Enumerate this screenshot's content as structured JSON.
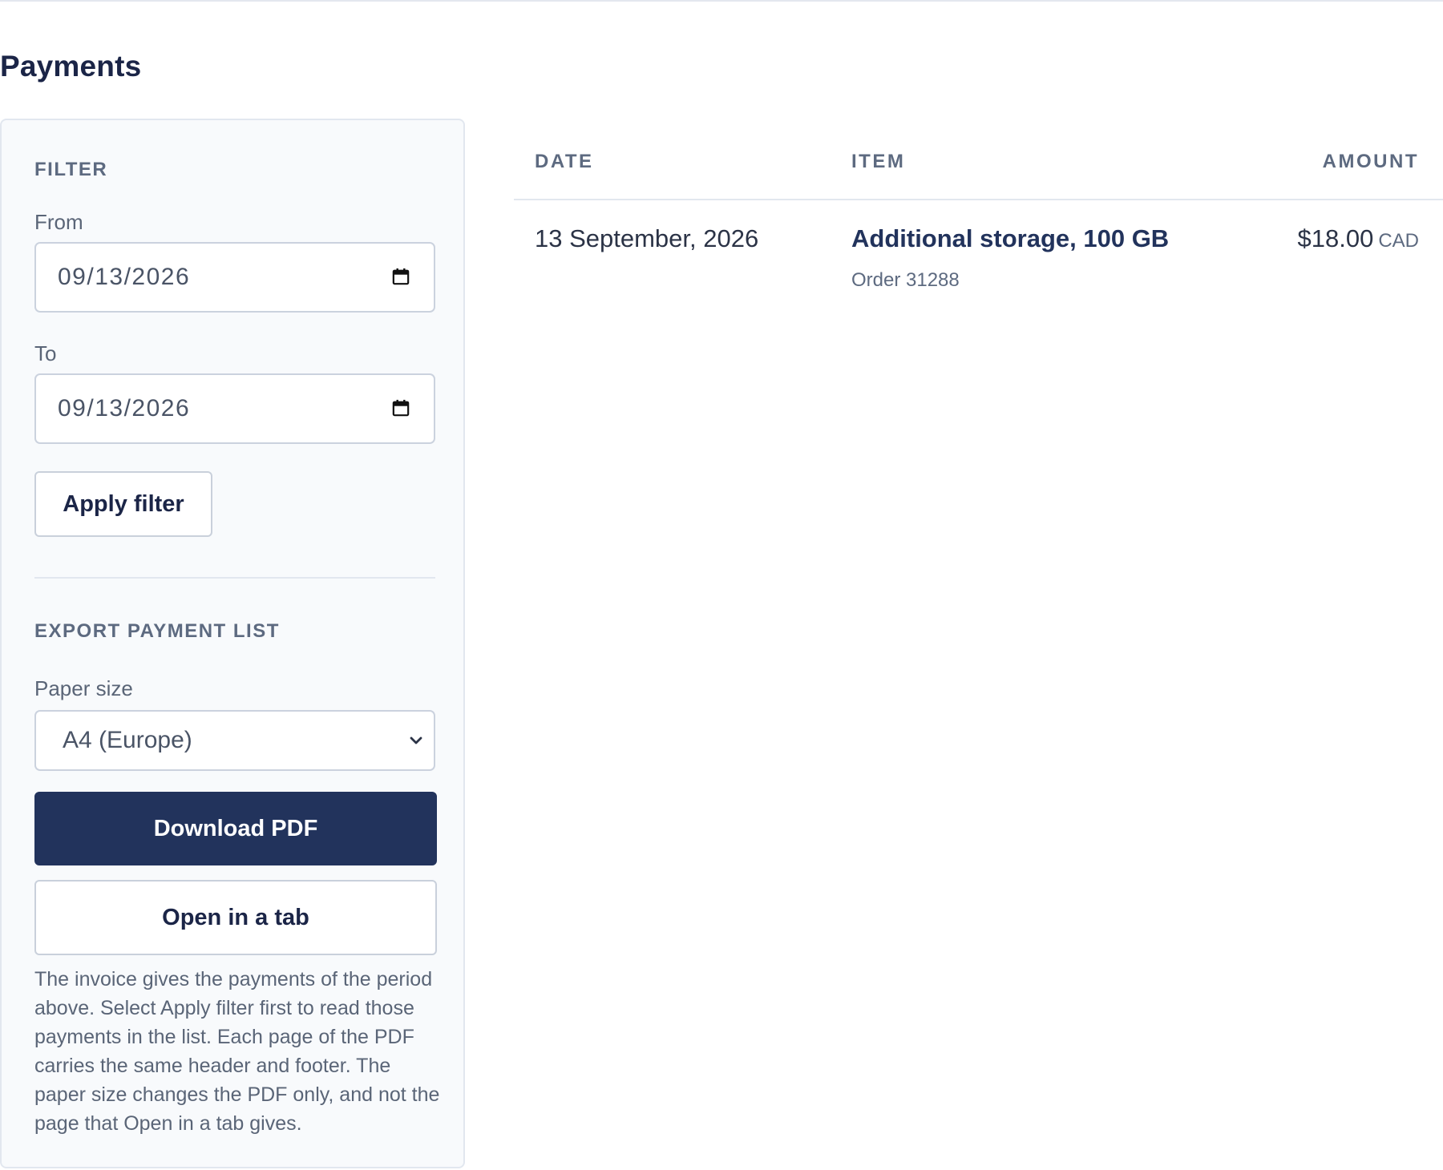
{
  "page": {
    "title": "Payments"
  },
  "filter": {
    "heading": "FILTER",
    "from_label": "From",
    "from_value": "09/13/2026",
    "to_label": "To",
    "to_value": "09/13/2026",
    "apply_label": "Apply filter",
    "icon": "calendar-icon"
  },
  "export": {
    "heading": "EXPORT PAYMENT LIST",
    "paper_size_label": "Paper size",
    "paper_size_value": "A4 (Europe)",
    "download_label": "Download PDF",
    "open_tab_label": "Open in a tab",
    "help_text": "The invoice gives the payments of the period above. Select Apply filter first to read those payments in the list. Each page of the PDF carries the same header and footer. The paper size changes the PDF only, and not the page that Open in a tab gives."
  },
  "table": {
    "columns": {
      "date": "DATE",
      "item": "ITEM",
      "amount": "AMOUNT"
    },
    "rows": [
      {
        "date": "13 September, 2026",
        "item": "Additional storage, 100 GB",
        "order": "Order 31288",
        "amount": "$18.00",
        "currency": "CAD"
      }
    ]
  },
  "colors": {
    "primary": "#22335c",
    "heading": "#1b2547",
    "muted": "#5d6a80",
    "panel_bg": "#f8fafc",
    "border": "#e2e7ef"
  }
}
